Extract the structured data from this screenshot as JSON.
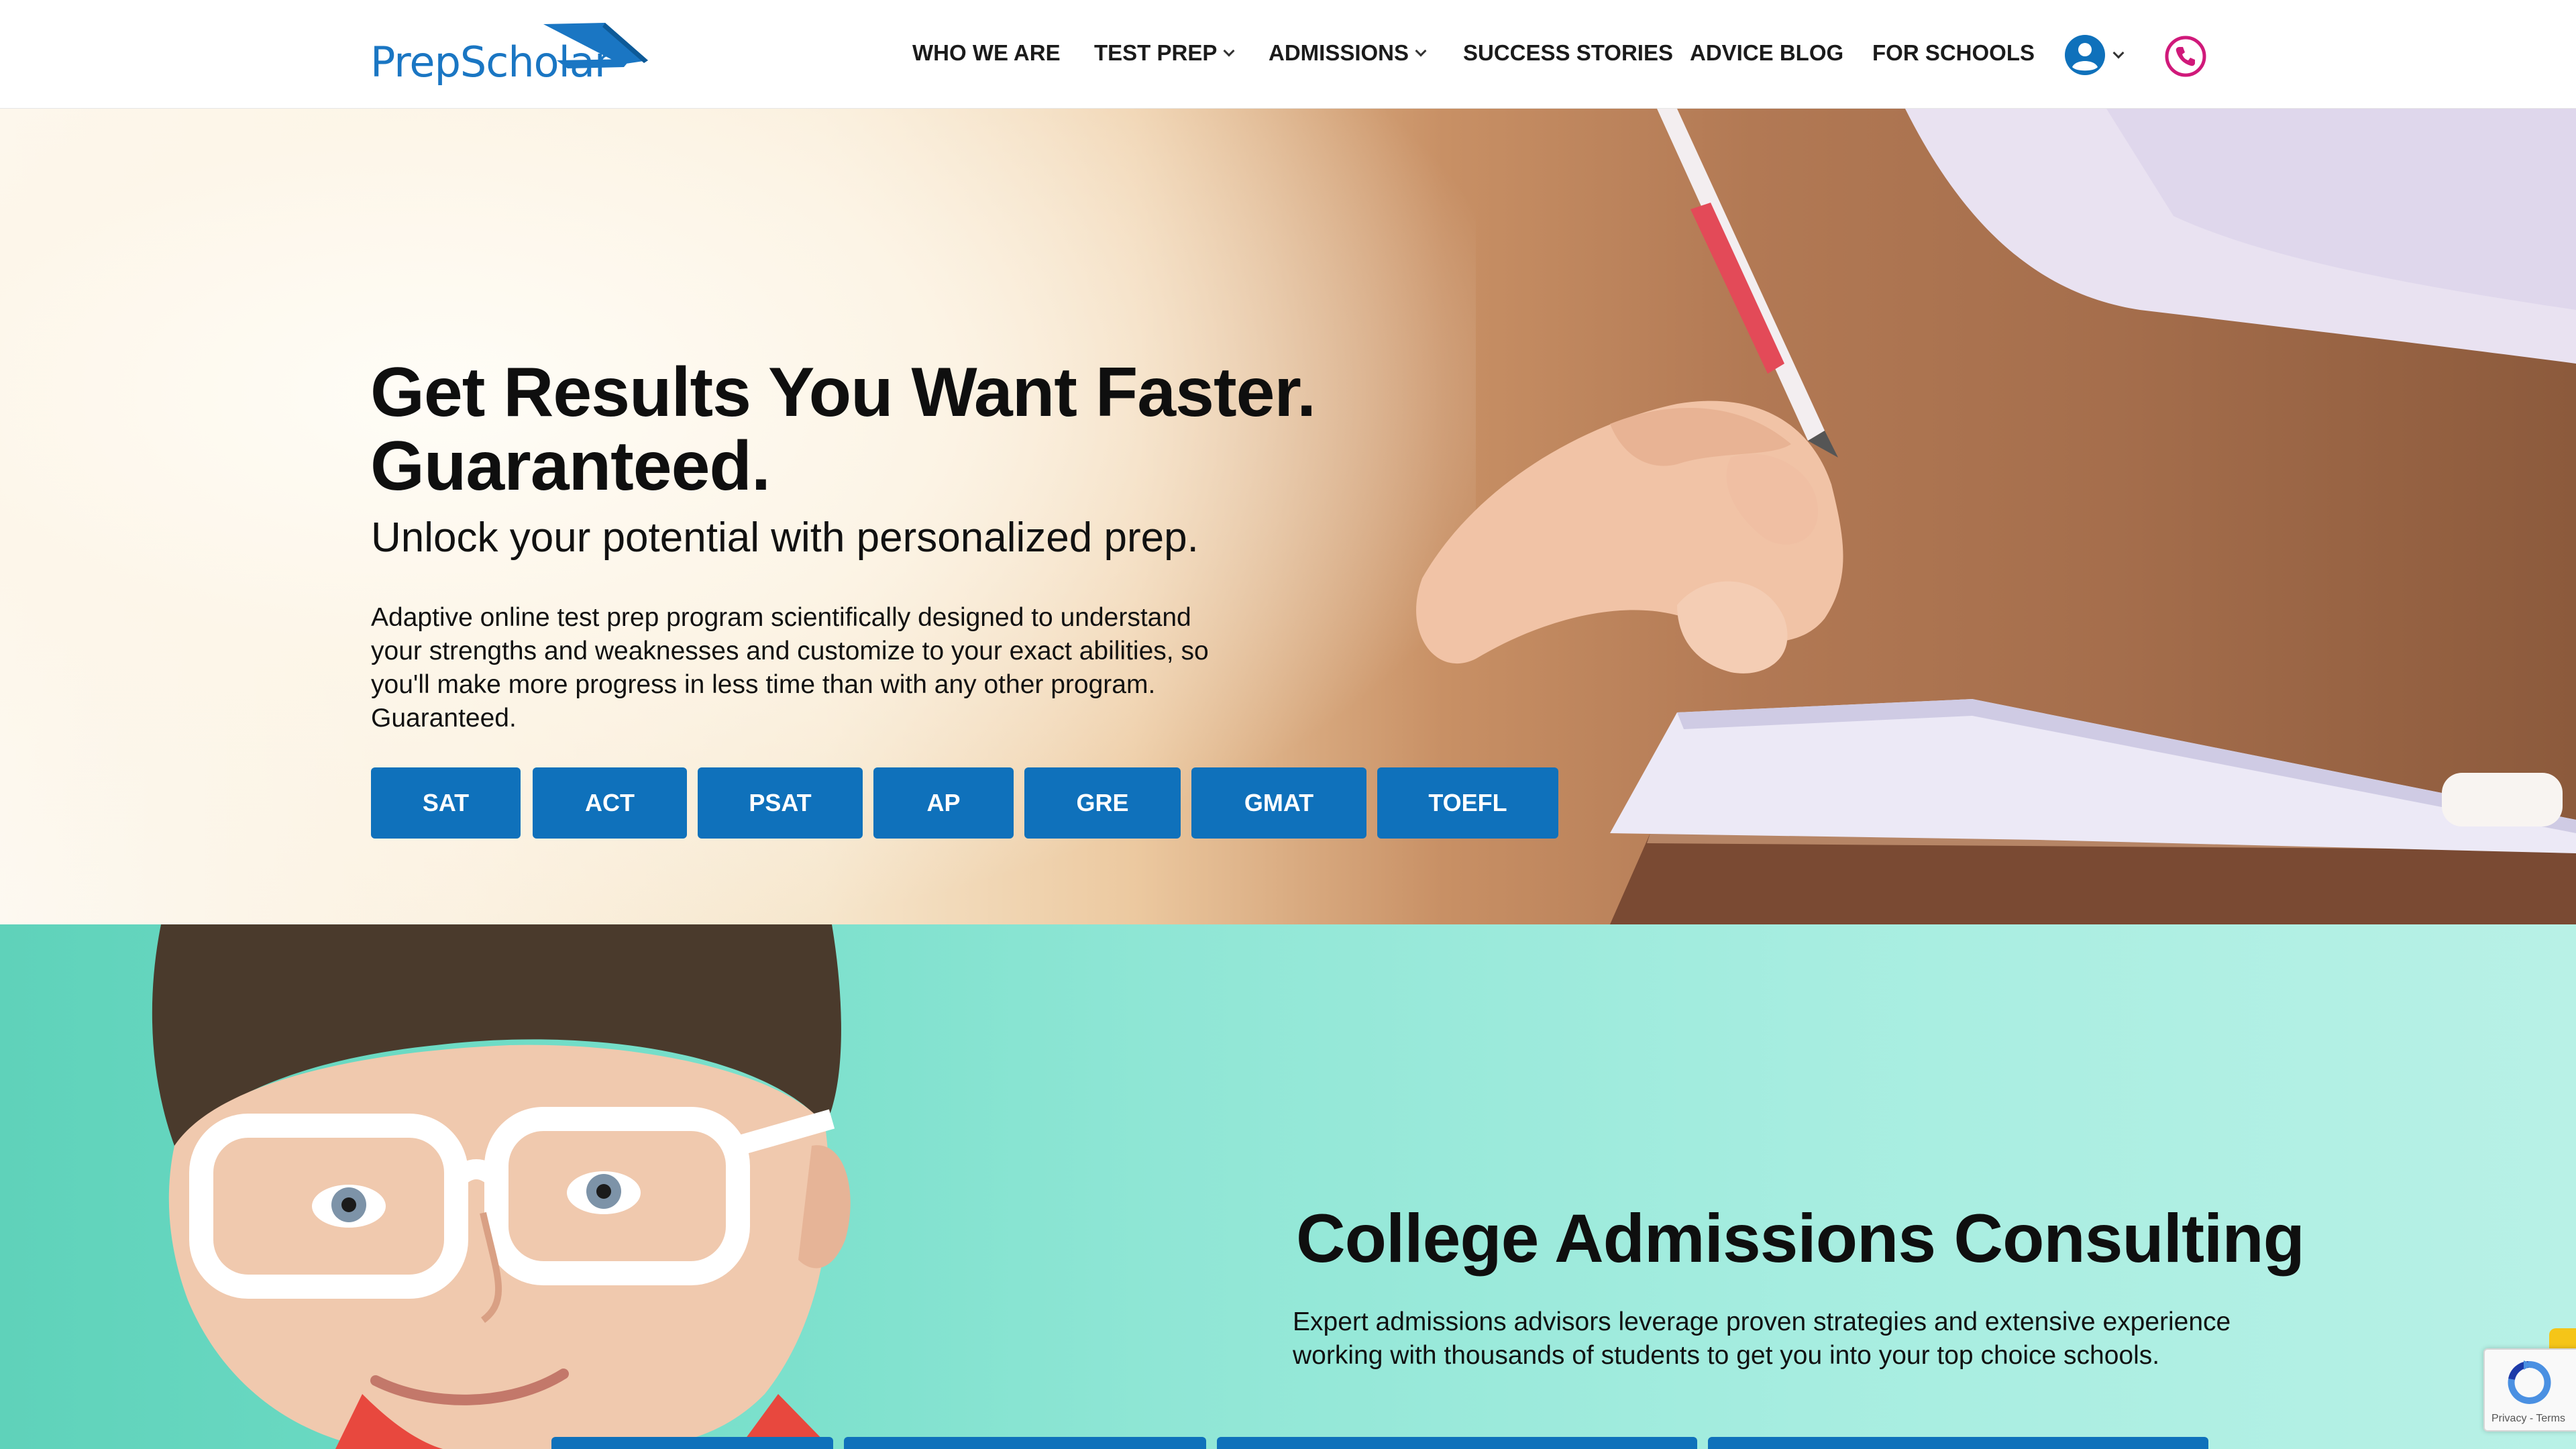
{
  "header": {
    "logo_text": "PrepScholar",
    "nav": [
      {
        "label": "WHO WE ARE",
        "has_dropdown": false
      },
      {
        "label": "TEST PREP",
        "has_dropdown": true
      },
      {
        "label": "ADMISSIONS",
        "has_dropdown": true
      },
      {
        "label": "SUCCESS STORIES",
        "has_dropdown": false
      },
      {
        "label": "ADVICE BLOG",
        "has_dropdown": false
      },
      {
        "label": "FOR SCHOOLS",
        "has_dropdown": false
      }
    ],
    "user_icon": "user-circle-icon",
    "phone_icon": "phone-icon"
  },
  "hero": {
    "title_line1": "Get Results You Want Faster.",
    "title_line2": "Guaranteed.",
    "subtitle": "Unlock your potential with personalized prep.",
    "description": "Adaptive online test prep program scientifically designed to understand your strengths and weaknesses and customize to your exact abilities, so you'll make more progress in less time than with any other program. Guaranteed.",
    "tests": [
      "SAT",
      "ACT",
      "PSAT",
      "AP",
      "GRE",
      "GMAT",
      "TOEFL"
    ]
  },
  "admissions": {
    "title": "College Admissions Consulting",
    "description": "Expert admissions advisors leverage proven strategies and extensive experience working with thousands of students to get you into your top choice schools."
  },
  "recaptcha": {
    "text": "Privacy - Terms"
  },
  "colors": {
    "brand_blue": "#0f71bb",
    "logo_blue": "#1a76c3",
    "phone_pink": "#d0197a",
    "admissions_teal": "#8fe6d5"
  }
}
